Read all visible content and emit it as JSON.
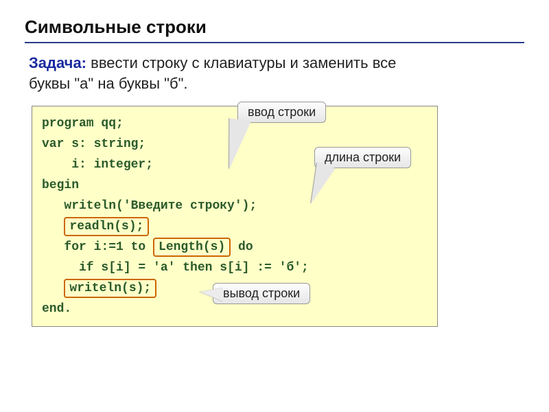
{
  "title": "Символьные строки",
  "task": {
    "label": "Задача:",
    "text_line1": " ввести строку с клавиатуры и заменить все",
    "text_line2": "буквы \"а\" на буквы \"б\"."
  },
  "code": {
    "l1": "program qq;",
    "l2": "var s: string;",
    "l3": "    i: integer;",
    "l4": "begin",
    "l5": "   writeln('Введите строку');",
    "l6_pre": "   ",
    "l6_box": "readln(s);",
    "l7_pre": "   for i:=1 to ",
    "l7_box": "Length(s)",
    "l7_post": " do",
    "l8": "     if s[i] = 'а' then s[i] := 'б';",
    "l9_pre": "   ",
    "l9_box": "writeln(s);",
    "l10": "end."
  },
  "callouts": {
    "c1": "ввод строки",
    "c2": "длина строки",
    "c3": "вывод строки"
  }
}
